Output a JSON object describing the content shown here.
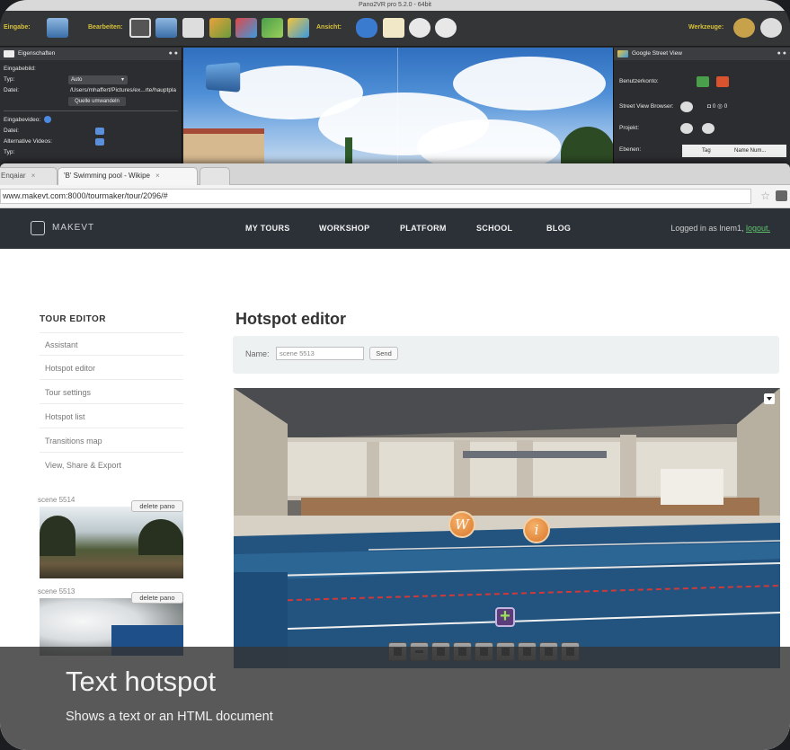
{
  "pano2vr": {
    "window_title": "Pano2VR pro 5.2.0 - 64bit",
    "toolbar": {
      "eingabe_label": "Eingabe:",
      "bearbeiten_label": "Bearbeiten:",
      "ansicht_label": "Ansicht:",
      "werkzeuge_label": "Werkzeuge:"
    },
    "left_panel": {
      "title": "Eigenschaften",
      "eingabebild_label": "Eingabebild:",
      "typ_label": "Typ:",
      "typ_value": "Auto",
      "datei_label": "Datei:",
      "datei_value": "/Users/mhaffert/Pictures/ex...rte/hauptpla",
      "convert_button": "Quelle umwandeln",
      "eingabevideo_label": "Eingabevideo:",
      "datei2_label": "Datei:",
      "alt_videos_label": "Alternative Videos:",
      "typ2_label": "Typ:"
    },
    "right_panel": {
      "title": "Google Street View",
      "account_label": "Benutzerkonto:",
      "browser_label": "Street View Browser:",
      "browser_counts": "0  ◎ 0",
      "projekt_label": "Projekt:",
      "ebenen_label": "Ebenen:",
      "col_tag": "Tag",
      "col_name": "Name Num..."
    }
  },
  "browser": {
    "tabs": [
      {
        "label": "Enqaiar"
      },
      {
        "label": "'B' Swimming pool - Wikipe"
      },
      {
        "label": ""
      }
    ],
    "url": "www.makevt.com:8000/tourmaker/tour/2096/#"
  },
  "site": {
    "brand": "MAKEVT",
    "nav": [
      "MY TOURS",
      "WORKSHOP",
      "PLATFORM",
      "SCHOOL",
      "BLOG"
    ],
    "logged_in_prefix": "Logged in as lnem1,",
    "logout": "logout."
  },
  "sidebar": {
    "title": "TOUR EDITOR",
    "items": [
      "Assistant",
      "Hotspot editor",
      "Tour settings",
      "Hotspot list",
      "Transitions map",
      "View, Share & Export"
    ],
    "scenes": [
      {
        "name": "scene 5514",
        "delete_label": "delete pano"
      },
      {
        "name": "scene 5513",
        "delete_label": "delete pano"
      }
    ]
  },
  "editor": {
    "title": "Hotspot editor",
    "name_label": "Name:",
    "name_value": "scene 5513",
    "send_label": "Send"
  },
  "caption": {
    "title": "Text hotspot",
    "subtitle": "Shows a text or an HTML document"
  },
  "colors": {
    "navbar": "#2c3138",
    "logout_link": "#5fc26b",
    "pano2vr_label": "#d8c23a",
    "hotspot_orange": "#d9762b"
  },
  "icons": {
    "hotspot_w": "wikipedia-hotspot-icon",
    "hotspot_i": "info-hotspot-icon",
    "add": "add-hotspot-icon"
  }
}
